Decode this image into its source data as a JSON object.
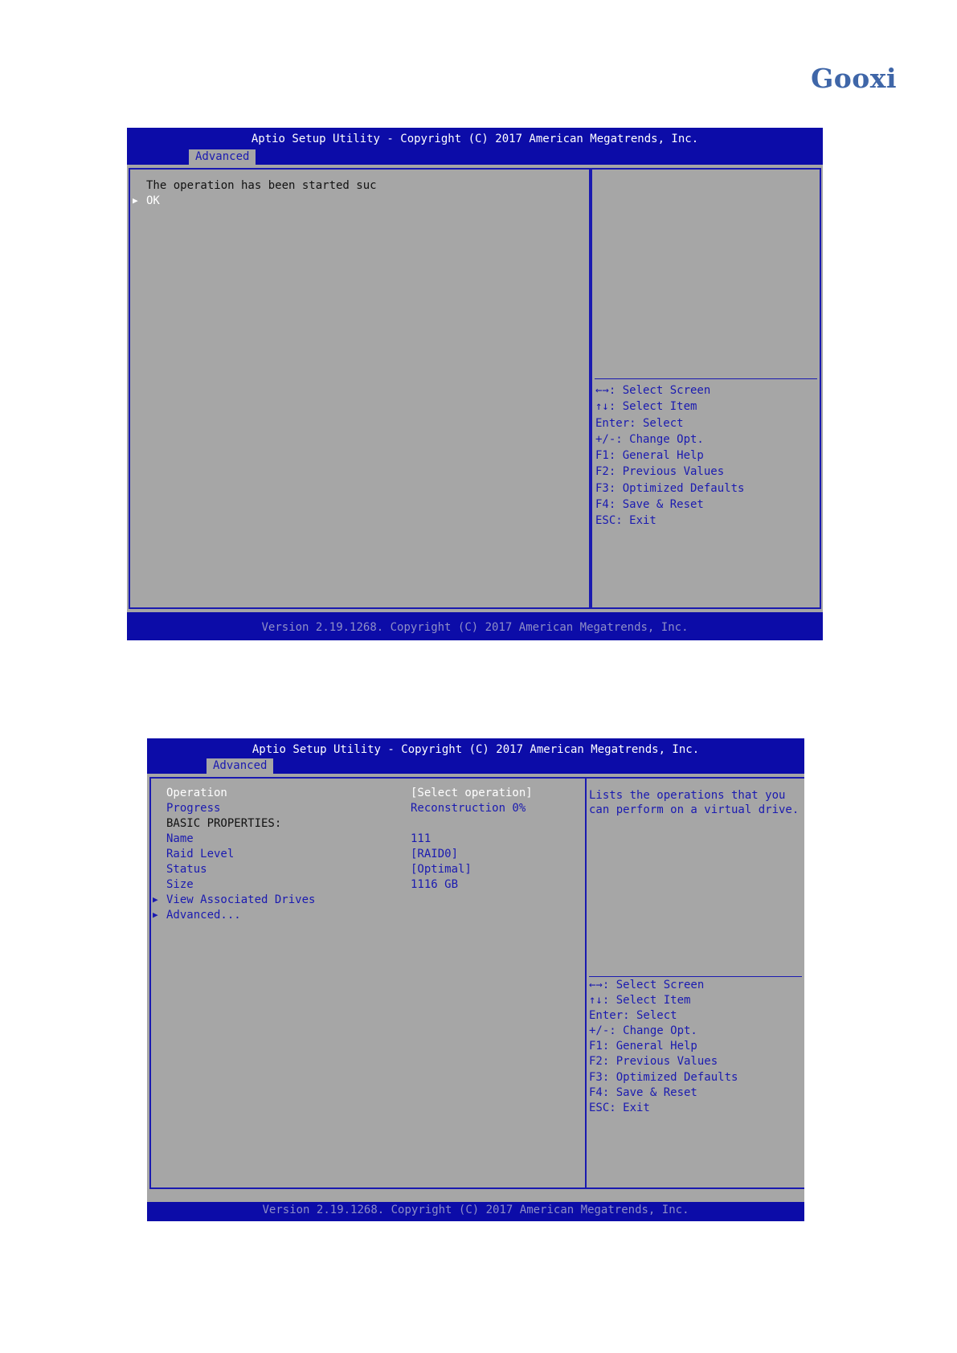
{
  "brand": {
    "logo_text": "Gooxi"
  },
  "screen1": {
    "title": "Aptio Setup Utility - Copyright (C) 2017 American Megatrends, Inc.",
    "tab": "Advanced",
    "message": "The operation has been started suc",
    "ok_label": "OK",
    "help": [
      "←→: Select Screen",
      "↑↓: Select Item",
      "Enter: Select",
      "+/-: Change Opt.",
      "F1: General Help",
      "F2: Previous Values",
      "F3: Optimized Defaults",
      "F4: Save & Reset",
      "ESC: Exit"
    ],
    "footer": "Version 2.19.1268. Copyright (C) 2017 American Megatrends, Inc."
  },
  "screen2": {
    "title": "Aptio Setup Utility - Copyright (C) 2017 American Megatrends, Inc.",
    "tab": "Advanced",
    "operation": {
      "label": "Operation",
      "value": "[Select operation]"
    },
    "progress": {
      "label": "Progress",
      "value": "Reconstruction 0%"
    },
    "basic_properties_heading": "BASIC PROPERTIES:",
    "name": {
      "label": "Name",
      "value": "111"
    },
    "raid_level": {
      "label": "Raid Level",
      "value": "[RAID0]"
    },
    "status": {
      "label": "Status",
      "value": "[Optimal]"
    },
    "size": {
      "label": "Size",
      "value": "1116 GB"
    },
    "view_associated_drives": "View Associated Drives",
    "advanced_link": "Advanced...",
    "description": [
      "Lists the operations that you",
      "can perform on a virtual drive."
    ],
    "help": [
      "←→: Select Screen",
      "↑↓: Select Item",
      "Enter: Select",
      "+/-: Change Opt.",
      "F1: General Help",
      "F2: Previous Values",
      "F3: Optimized Defaults",
      "F4: Save & Reset",
      "ESC: Exit"
    ],
    "footer": "Version 2.19.1268. Copyright (C) 2017 American Megatrends, Inc."
  },
  "colors": {
    "bios_blue": "#0c0ca8",
    "bios_gray": "#a6a6a6",
    "text_blue": "#1a1ab0",
    "logo_blue": "#3f66a8"
  }
}
